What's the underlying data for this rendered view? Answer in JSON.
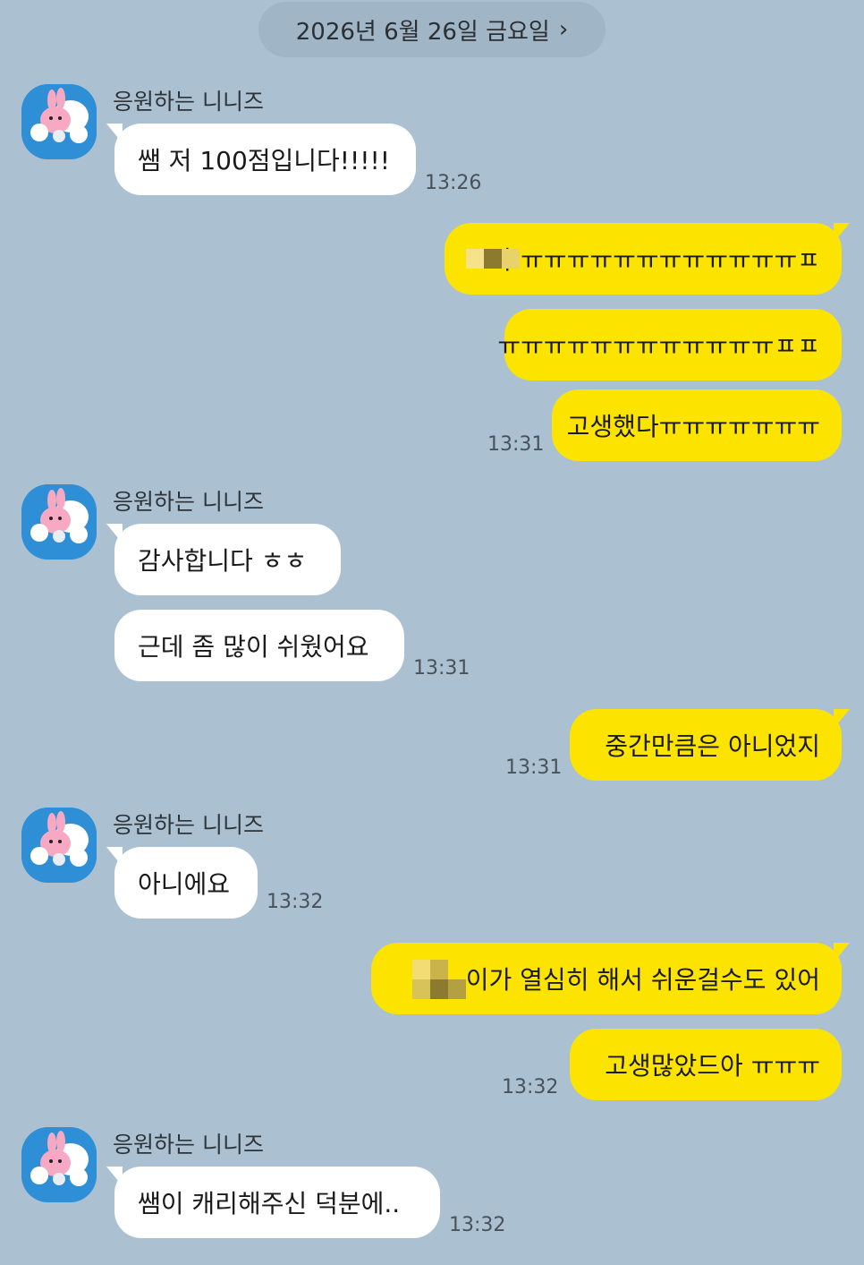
{
  "date_header": {
    "label": "2026년 6월 26일 금요일",
    "chevron_icon": "chevron-right-icon"
  },
  "contact": {
    "name": "응원하는 니니즈",
    "avatar_icon": "ninize-character-avatar"
  },
  "messages": [
    {
      "sender": "응원하는 니니즈",
      "text": "쌤 저 100점입니다!!!!!",
      "time": "13:26"
    },
    {
      "text": "아 ㅠㅠㅠㅠㅠㅠㅠㅠㅠㅠㅠㅠㅍ"
    },
    {
      "text": "ㅠㅠㅠㅠㅠㅠㅠㅠㅠㅠㅠㅠㅍㅍ"
    },
    {
      "text": "고생했다ㅠㅠㅠㅠㅠㅠㅠ",
      "time": "13:31"
    },
    {
      "sender": "응원하는 니니즈",
      "text": "감사합니다 ㅎㅎ"
    },
    {
      "text": "근데 좀 많이 쉬웠어요",
      "time": "13:31"
    },
    {
      "text": "중간만큼은 아니었지",
      "time": "13:31"
    },
    {
      "sender": "응원하는 니니즈",
      "text": "아니에요",
      "time": "13:32"
    },
    {
      "text": "이가 열심히 해서 쉬운걸수도 있어"
    },
    {
      "text": "고생많았드아 ㅠㅠㅠ",
      "time": "13:32"
    },
    {
      "sender": "응원하는 니니즈",
      "text": "쌤이 캐리해주신 덕분에..",
      "time": "13:32"
    }
  ],
  "colors": {
    "background": "#abc1d1",
    "incoming_bubble": "#ffffff",
    "outgoing_bubble": "#fde400",
    "date_pill": "#a0b5c5"
  }
}
